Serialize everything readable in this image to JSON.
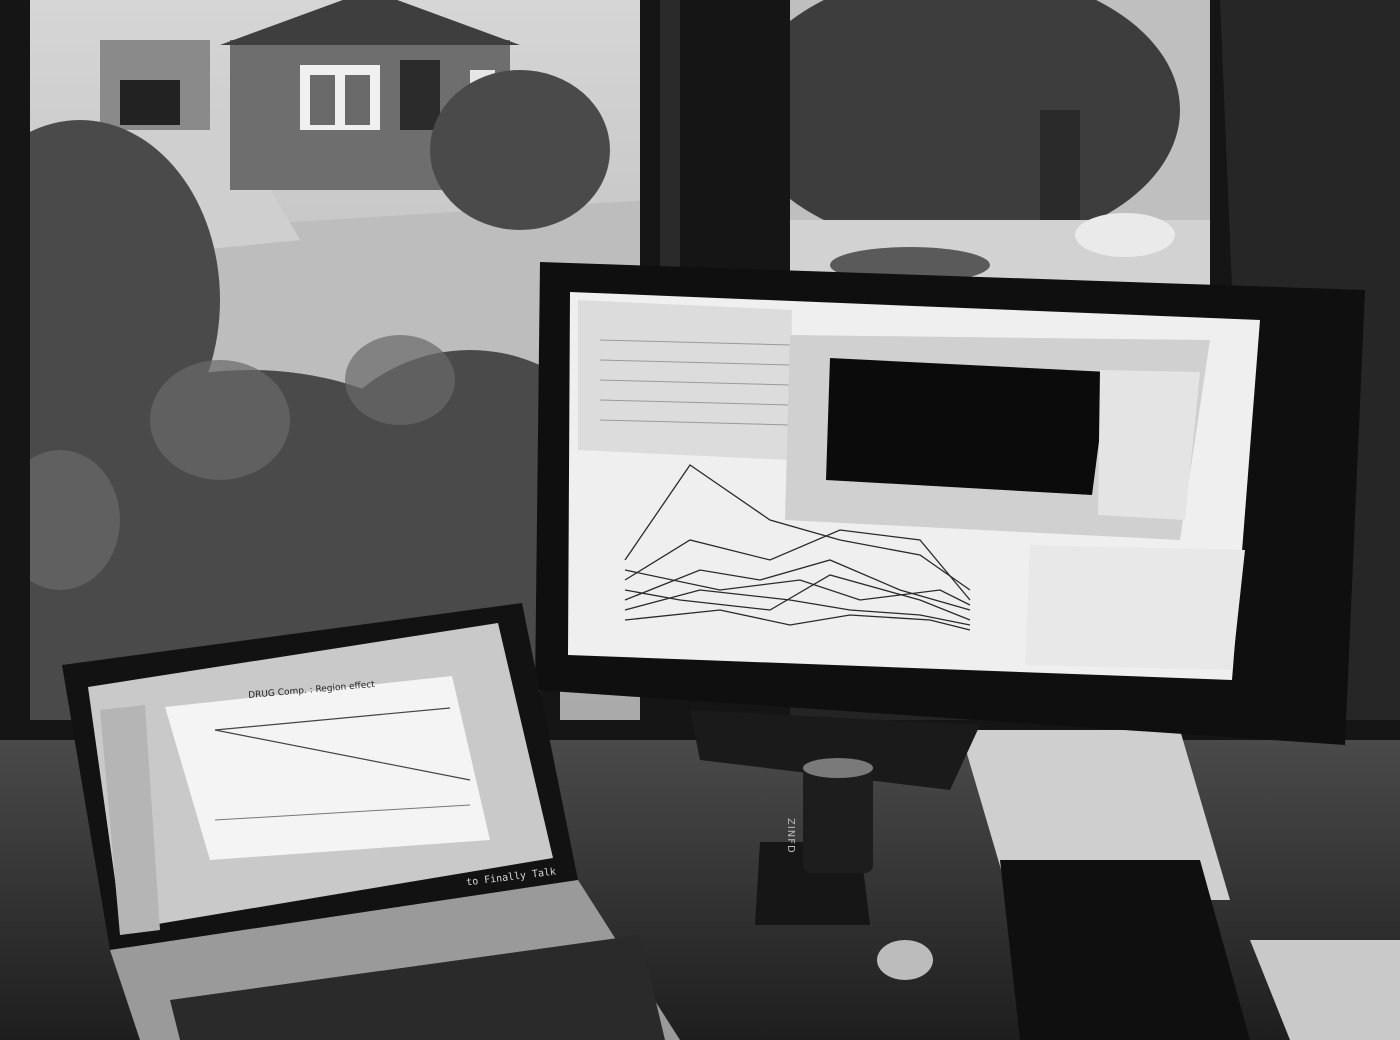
{
  "palette": {
    "window_frame": "#161616",
    "outdoor_light": "#d9d9d9",
    "foliage": "#4a4a4a",
    "screen_glow": "#f2f2f2",
    "desk": "#3a3a3a"
  },
  "laptop": {
    "chart_title": "DRUG Comp. : Region effect",
    "caption": "to Finally Talk"
  },
  "monitor": {
    "app_windows": [
      "spreadsheet",
      "line-plot",
      "dialog"
    ]
  },
  "can": {
    "label": "ZINFD"
  }
}
